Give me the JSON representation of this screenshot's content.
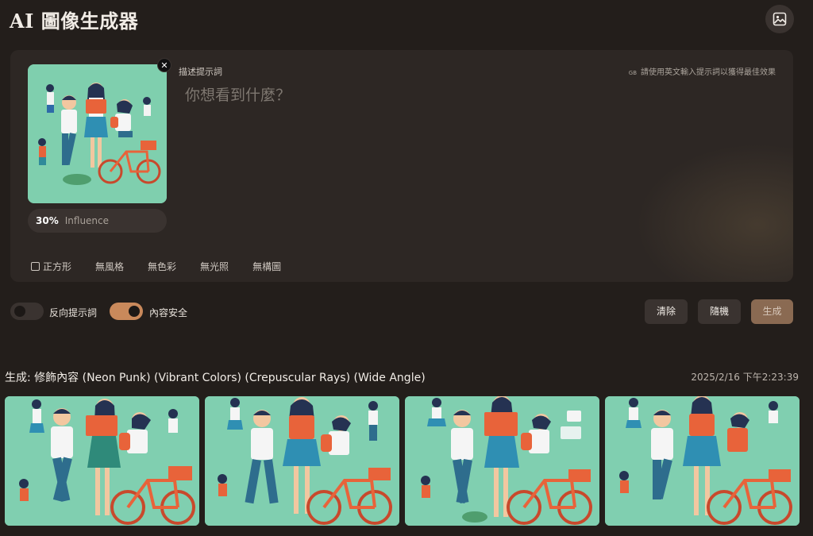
{
  "header": {
    "title": "AI 圖像生成器",
    "image_button_icon": "image-icon"
  },
  "prompt_panel": {
    "label": "描述提示詞",
    "hint_badge": "GB",
    "hint": "請使用英文輸入提示詞以獲得最佳效果",
    "placeholder": "你想看到什麼？",
    "reference_image": {
      "alt": "Illustration of students walking and riding a bicycle",
      "close_icon": "close-icon"
    },
    "influence": {
      "value": "30%",
      "label": "Influence"
    },
    "options": [
      {
        "label": "正方形",
        "checkbox": true
      },
      {
        "label": "無風格"
      },
      {
        "label": "無色彩"
      },
      {
        "label": "無光照"
      },
      {
        "label": "無構圖"
      }
    ]
  },
  "controls": {
    "negative_prompt": {
      "label": "反向提示詞",
      "on": false
    },
    "content_safety": {
      "label": "內容安全",
      "on": true
    },
    "clear_label": "清除",
    "random_label": "隨機",
    "generate_label": "生成"
  },
  "result": {
    "title": "生成: 修飾內容 (Neon Punk) (Vibrant Colors) (Crepuscular Rays) (Wide Angle)",
    "timestamp": "2025/2/16 下午2:23:39",
    "images": [
      {
        "alt": "generated image 1"
      },
      {
        "alt": "generated image 2"
      },
      {
        "alt": "generated image 3"
      },
      {
        "alt": "generated image 4"
      }
    ]
  },
  "colors": {
    "background": "#231e1b",
    "panel": "#2d2724",
    "toggle_on": "#c9895b",
    "generate_button": "#8a6a52",
    "illustration_bg": "#80cfb0"
  }
}
